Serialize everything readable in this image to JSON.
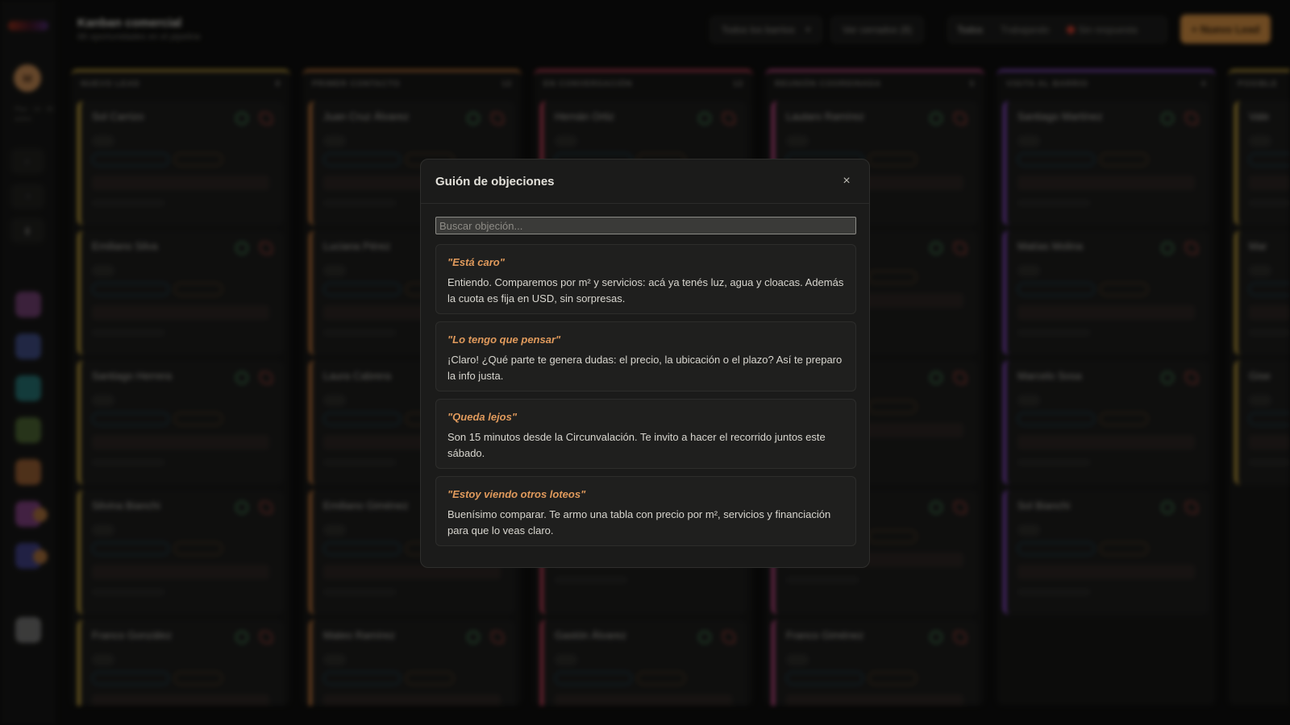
{
  "app": {
    "title": "Kanban comercial",
    "subtitle": "88 oportunidades en el pipeline",
    "avatar_initial": "M",
    "plan_text": "Plan · 14 · 30 activo"
  },
  "toolbar": {
    "filter_select": "Todos los barrios",
    "closed_button": "Ver cerrados (8)",
    "views": [
      "Todos",
      "Trabajando",
      "Sin respuesta"
    ],
    "new_lead_button": "+ Nuevo Lead"
  },
  "board": {
    "columns": [
      {
        "title": "NUEVO LEAD",
        "count": "8",
        "color": "#c9a43a",
        "cards": [
          "Sol Carrizo",
          "Emiliano Silva",
          "Santiago Herrera",
          "Silvina Bianchi",
          "Franco González"
        ]
      },
      {
        "title": "PRIMER CONTACTO",
        "count": "12",
        "color": "#c97a3a",
        "cards": [
          "Juan Cruz Álvarez",
          "Luciana Pérez",
          "Laura Cabrera",
          "Emiliano Giménez",
          "Mateo Ramírez"
        ]
      },
      {
        "title": "EN CONVERSACIÓN",
        "count": "12",
        "color": "#c9405a",
        "cards": [
          "Hernán Ortiz",
          "",
          "",
          "",
          "Gastón Álvarez"
        ]
      },
      {
        "title": "REUNIÓN COORDINADA",
        "count": "5",
        "color": "#c94a8a",
        "cards": [
          "Lautaro Ramírez",
          "",
          "",
          "",
          "Franco Giménez"
        ]
      },
      {
        "title": "VISITA AL BARRIO",
        "count": "4",
        "color": "#8a4ac9",
        "cards": [
          "Santiago Martínez",
          "Matías Molina",
          "Marcelo Sosa",
          "Sol Bianchi"
        ]
      },
      {
        "title": "POSIBLE",
        "count": "",
        "color": "#c9a43a",
        "cards": [
          "Vale",
          "Mar",
          "Gise"
        ]
      }
    ]
  },
  "modal": {
    "title": "Guión de objeciones",
    "search_placeholder": "Buscar objeción...",
    "objections": [
      {
        "title": "\"Está caro\"",
        "answer": "Entiendo. Comparemos por m² y servicios: acá ya tenés luz, agua y cloacas. Además la cuota es fija en USD, sin sorpresas."
      },
      {
        "title": "\"Lo tengo que pensar\"",
        "answer": "¡Claro! ¿Qué parte te genera dudas: el precio, la ubicación o el plazo? Así te preparo la info justa."
      },
      {
        "title": "\"Queda lejos\"",
        "answer": "Son 15 minutos desde la Circunvalación. Te invito a hacer el recorrido juntos este sábado."
      },
      {
        "title": "\"Estoy viendo otros loteos\"",
        "answer": "Buenísimo comparar. Te armo una tabla con precio por m², servicios y financiación para que lo veas claro."
      }
    ]
  }
}
